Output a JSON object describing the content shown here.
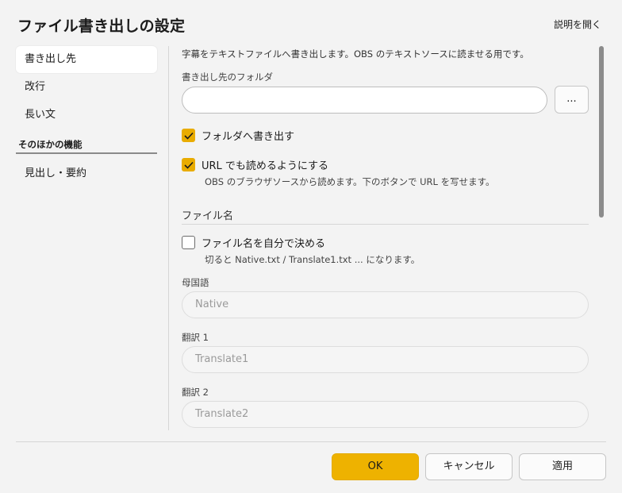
{
  "window": {
    "title": "ファイル書き出しの設定",
    "help_link": "説明を開く"
  },
  "sidebar": {
    "items": [
      {
        "label": "書き出し先",
        "active": true
      },
      {
        "label": "改行"
      },
      {
        "label": "長い文"
      }
    ],
    "section_label": "そのほかの機能",
    "extra_items": [
      {
        "label": "見出し・要約"
      }
    ]
  },
  "main": {
    "description": "字幕をテキストファイルへ書き出します。OBS のテキストソースに読ませる用です。",
    "folder": {
      "label": "書き出し先のフォルダ",
      "value": "",
      "browse_label": "..."
    },
    "write_to_folder": {
      "label": "フォルダへ書き出す",
      "checked": true
    },
    "url_readable": {
      "label": "URL でも読めるようにする",
      "checked": true,
      "hint": "OBS のブラウザソースから読めます。下のボタンで URL を写せます。"
    },
    "file_name_section": "ファイル名",
    "custom_file_name": {
      "label": "ファイル名を自分で決める",
      "checked": false,
      "hint": "切ると Native.txt / Translate1.txt ... になります。"
    },
    "native_language": {
      "label": "母国語",
      "placeholder": "Native"
    },
    "translation1": {
      "label": "翻訳 1",
      "placeholder": "Translate1"
    },
    "translation2": {
      "label": "翻訳 2",
      "placeholder": "Translate2"
    }
  },
  "footer": {
    "ok_label": "OK",
    "cancel_label": "キャンセル",
    "apply_label": "適用"
  },
  "colors": {
    "accent": "#eeb200",
    "checkbox": "#e9ac00",
    "background": "#f3f3f3"
  }
}
